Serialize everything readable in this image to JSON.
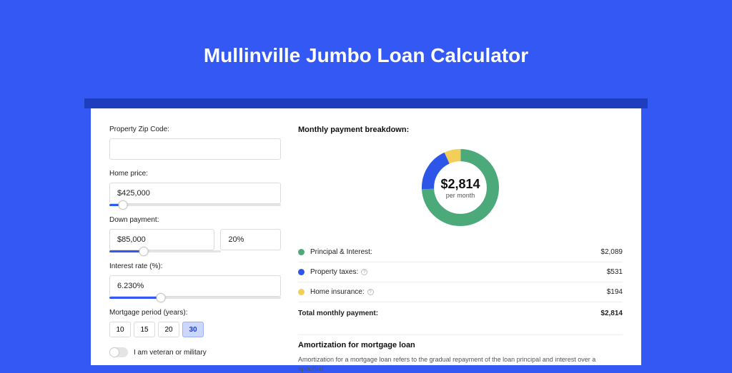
{
  "title": "Mullinville Jumbo Loan Calculator",
  "form": {
    "zip_label": "Property Zip Code:",
    "zip_value": "",
    "home_price_label": "Home price:",
    "home_price_value": "$425,000",
    "home_price_slider_pct": 8,
    "down_payment_label": "Down payment:",
    "down_payment_value": "$85,000",
    "down_payment_pct_value": "20%",
    "down_payment_slider_pct": 20,
    "interest_label": "Interest rate (%):",
    "interest_value": "6.230%",
    "interest_slider_pct": 30,
    "period_label": "Mortgage period (years):",
    "periods": [
      "10",
      "15",
      "20",
      "30"
    ],
    "period_selected": "30",
    "veteran_label": "I am veteran or military"
  },
  "breakdown": {
    "heading": "Monthly payment breakdown:",
    "total_amount": "$2,814",
    "per_month": "per month",
    "rows": [
      {
        "color": "green",
        "label": "Principal & Interest:",
        "value": "$2,089",
        "info": false
      },
      {
        "color": "blue",
        "label": "Property taxes:",
        "value": "$531",
        "info": true
      },
      {
        "color": "yellow",
        "label": "Home insurance:",
        "value": "$194",
        "info": true
      }
    ],
    "total_label": "Total monthly payment:",
    "total_value": "$2,814"
  },
  "amortization": {
    "heading": "Amortization for mortgage loan",
    "text": "Amortization for a mortgage loan refers to the gradual repayment of the loan principal and interest over a specified"
  },
  "chart_data": {
    "type": "pie",
    "title": "Monthly payment breakdown",
    "series": [
      {
        "name": "Principal & Interest",
        "value": 2089,
        "color": "#4ba97a"
      },
      {
        "name": "Property taxes",
        "value": 531,
        "color": "#2d56e8"
      },
      {
        "name": "Home insurance",
        "value": 194,
        "color": "#f3ce58"
      }
    ],
    "total": 2814,
    "center_label": "$2,814 per month",
    "donut": true
  }
}
